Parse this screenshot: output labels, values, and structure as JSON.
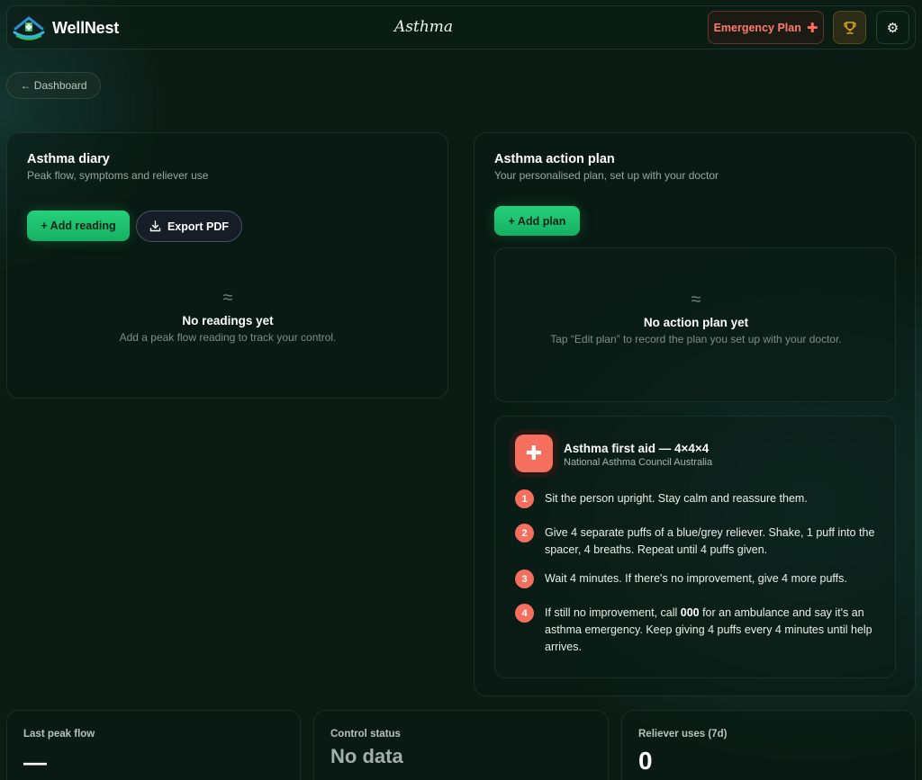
{
  "app": {
    "name": "WellNest",
    "page_title": "Asthma"
  },
  "header": {
    "emergency_label": "Emergency Plan",
    "emergency_icon": "plus-icon",
    "trophy_icon": "trophy-icon",
    "settings_icon": "gear-icon"
  },
  "nav": {
    "back_label": "← Dashboard"
  },
  "diary": {
    "title": "Asthma diary",
    "subtitle": "Peak flow, symptoms and reliever use",
    "add_label": "+ Add reading",
    "export_label": "Export PDF",
    "empty_icon": "≈",
    "empty_title": "No readings yet",
    "empty_text": "Add a peak flow reading to track your control."
  },
  "plan": {
    "title": "Asthma action plan",
    "subtitle": "Your personalised plan, set up with your doctor",
    "add_label": "+ Add plan",
    "empty_icon": "≈",
    "empty_title": "No action plan yet",
    "empty_text": "Tap “Edit plan” to record the plan you set up with your doctor."
  },
  "first_aid": {
    "title": "Asthma first aid — 4×4×4",
    "source": "National Asthma Council Australia",
    "steps": [
      {
        "num": "1",
        "text": "Sit the person upright. Stay calm and reassure them."
      },
      {
        "num": "2",
        "text": "Give 4 separate puffs of a blue/grey reliever. Shake, 1 puff into the spacer, 4 breaths. Repeat until 4 puffs given."
      },
      {
        "num": "3",
        "text": "Wait 4 minutes. If there's no improvement, give 4 more puffs."
      },
      {
        "num": "4",
        "text_before": "If still no improvement, call ",
        "text_bold": "000",
        "text_after": " for an ambulance and say it's an asthma emergency. Keep giving 4 puffs every 4 minutes until help arrives."
      }
    ]
  },
  "stats": [
    {
      "label": "Last peak flow",
      "value": "—"
    },
    {
      "label": "Control status",
      "value": "No data"
    },
    {
      "label": "Reliever uses (7d)",
      "value": "0"
    }
  ],
  "colors": {
    "accent_green": "#1fc06e",
    "alert_red": "#f56f5f",
    "background": "#0b1c15"
  }
}
